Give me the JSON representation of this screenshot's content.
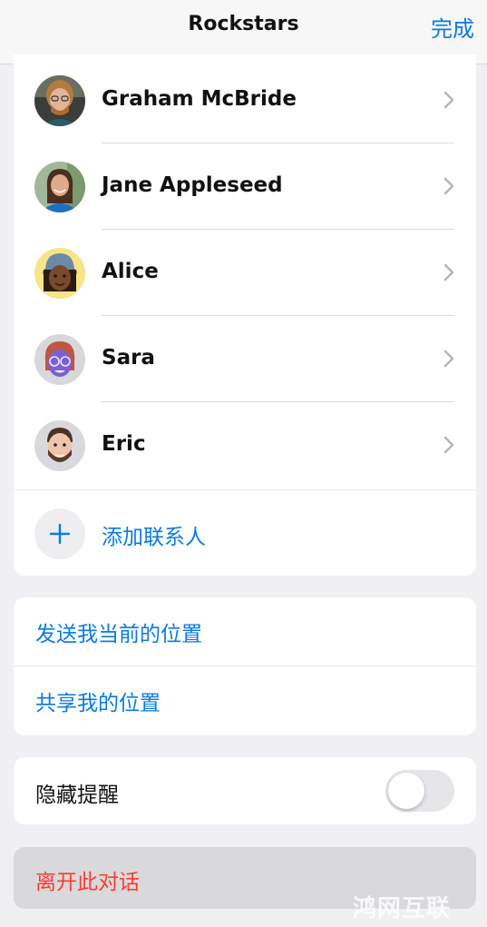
{
  "nav": {
    "title": "Rockstars",
    "done_label": "完成"
  },
  "members": [
    {
      "name": "Graham McBride",
      "avatar": "photo-man-beard-glasses"
    },
    {
      "name": "Jane Appleseed",
      "avatar": "photo-woman-smiling"
    },
    {
      "name": "Alice",
      "avatar": "memoji-beanie"
    },
    {
      "name": "Sara",
      "avatar": "memoji-purple-glasses"
    },
    {
      "name": "Eric",
      "avatar": "memoji-beard"
    }
  ],
  "add_contact": {
    "label": "添加联系人",
    "icon": "plus-icon"
  },
  "location": {
    "send_current": "发送我当前的位置",
    "share": "共享我的位置"
  },
  "hide_alerts": {
    "label": "隐藏提醒",
    "enabled": false
  },
  "leave": {
    "label": "离开此对话"
  },
  "watermark": "鸿网互联",
  "colors": {
    "accent": "#0a7ae0",
    "destructive": "#ff3b30"
  }
}
